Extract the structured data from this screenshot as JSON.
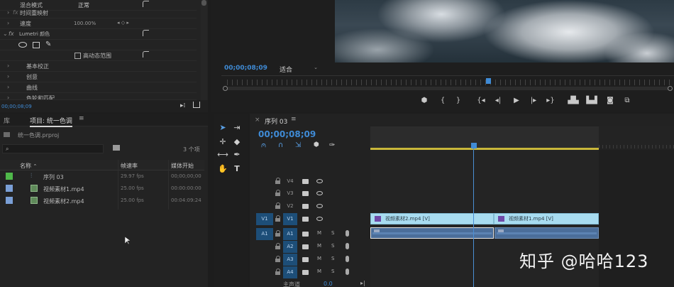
{
  "effects": {
    "rows": [
      {
        "arrow": "",
        "label": "混合模式",
        "value": "正常"
      },
      {
        "arrow": "›",
        "label": "时间重映射",
        "value": ""
      },
      {
        "arrow": "›",
        "label": "速度",
        "value": "100.00%"
      },
      {
        "arrow": "⌄",
        "label": "Lumetri 颜色",
        "value": ""
      },
      {
        "arrow": "",
        "label": "",
        "value": ""
      },
      {
        "arrow": "",
        "label": "高动态范围",
        "value": ""
      },
      {
        "arrow": "›",
        "label": "基本校正",
        "value": ""
      },
      {
        "arrow": "›",
        "label": "创意",
        "value": ""
      },
      {
        "arrow": "›",
        "label": "曲线",
        "value": ""
      },
      {
        "arrow": "›",
        "label": "色轮和匹配",
        "value": ""
      }
    ],
    "timecode": "00;00;08;09"
  },
  "program": {
    "timecode": "00;00;08;09",
    "fit": "适合",
    "controls": [
      "marker-icon",
      "mark-in-icon",
      "mark-out-icon",
      "go-to-in-icon",
      "step-back-icon",
      "play-icon",
      "step-forward-icon",
      "go-to-out-icon",
      "lift-icon",
      "extract-icon",
      "export-frame-icon",
      "compare-icon"
    ]
  },
  "project": {
    "library_tab": "库",
    "tab": "项目: 统一色调",
    "menu": "≡",
    "path": "统一色调.prproj",
    "count": "3 个项",
    "columns": {
      "name": "名称",
      "fps": "帧速率",
      "start": "媒体开始"
    },
    "items": [
      {
        "name": "序列 03",
        "fps": "29.97 fps",
        "start": "00;00;00;00",
        "color": "#4fb84a",
        "icon": "sequence-icon"
      },
      {
        "name": "视频素材1.mp4",
        "fps": "25.00 fps",
        "start": "00:00:00:00",
        "color": "#7a9fd6",
        "icon": "video-clip-icon"
      },
      {
        "name": "视频素材2.mp4",
        "fps": "25.00 fps",
        "start": "00:04:09:24",
        "color": "#7a9fd6",
        "icon": "video-clip-icon"
      }
    ]
  },
  "timeline": {
    "close": "×",
    "tab": "序列 03",
    "menu": "≡",
    "timecode": "00;00;08;09",
    "video_tracks": [
      {
        "name": "V4",
        "src": "",
        "on": false
      },
      {
        "name": "V3",
        "src": "",
        "on": false
      },
      {
        "name": "V2",
        "src": "",
        "on": false
      },
      {
        "name": "V1",
        "src": "V1",
        "on": true
      }
    ],
    "audio_tracks": [
      {
        "name": "A1",
        "src": "A1",
        "on": true
      },
      {
        "name": "A2",
        "src": "",
        "on": true
      },
      {
        "name": "A3",
        "src": "",
        "on": true
      },
      {
        "name": "A4",
        "src": "",
        "on": true
      }
    ],
    "master": {
      "label": "主声道",
      "value": "0.0"
    },
    "clips": {
      "v1a": "视频素材2.mp4 [V]",
      "v1b": "视频素材1.mp4 [V]"
    }
  },
  "watermark": "知乎 @哈哈123"
}
